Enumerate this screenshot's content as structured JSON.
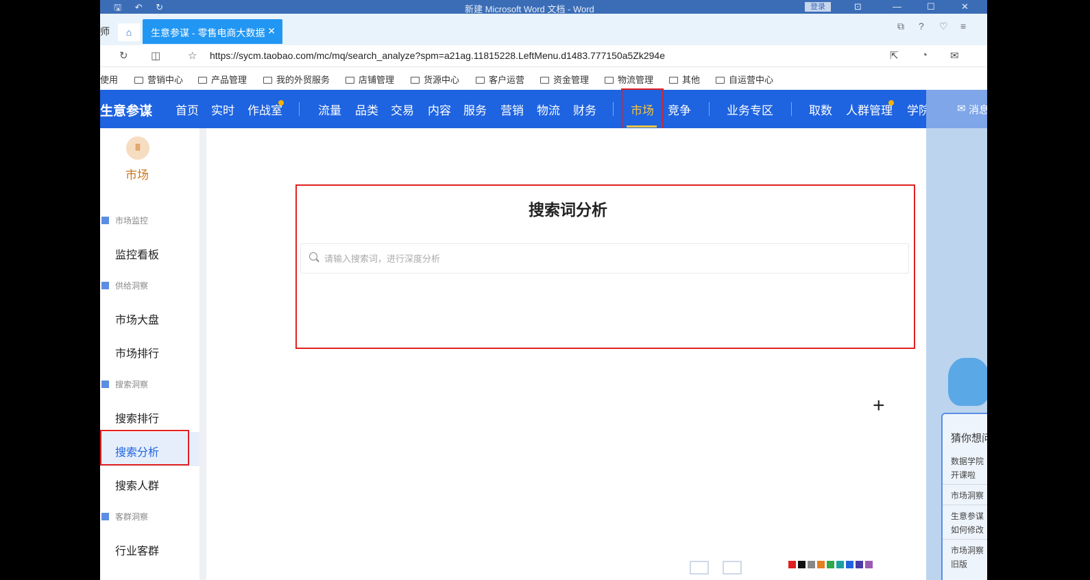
{
  "window": {
    "title": "新建 Microsoft Word 文档 - Word",
    "login_label": "登录",
    "quick_access": "🖫 ↶ ↻"
  },
  "tabs": {
    "prev_fragment": "师",
    "active_label": "生意参谋 - 零售电商大数据",
    "close_glyph": "✕"
  },
  "address": {
    "url": "https://sycm.taobao.com/mc/mq/search_analyze?spm=a21ag.11815228.LeftMenu.d1483.777150a5Zk294e"
  },
  "bookmarks": {
    "lead_fragment": "使用",
    "items": [
      "营销中心",
      "产品管理",
      "我的外贸服务",
      "店铺管理",
      "货源中心",
      "客户运营",
      "资金管理",
      "物流管理",
      "其他",
      "自运营中心"
    ]
  },
  "nav": {
    "brand": "生意参谋",
    "items": [
      "首页",
      "实时",
      "作战室",
      "流量",
      "品类",
      "交易",
      "内容",
      "服务",
      "营销",
      "物流",
      "财务",
      "市场",
      "竞争",
      "业务专区",
      "取数",
      "人群管理",
      "学院"
    ],
    "active": "市场",
    "message_fragment": "消息"
  },
  "sidebar": {
    "module_label": "市场",
    "sections": [
      {
        "title": "市场监控",
        "items": [
          "监控看板"
        ]
      },
      {
        "title": "供给洞察",
        "items": [
          "市场大盘",
          "市场排行"
        ]
      },
      {
        "title": "搜索洞察",
        "items": [
          "搜索排行",
          "搜索分析",
          "搜索人群"
        ]
      },
      {
        "title": "客群洞察",
        "items": [
          "行业客群"
        ]
      }
    ],
    "active_item": "搜索分析"
  },
  "main": {
    "title": "搜索词分析",
    "search_placeholder": "请输入搜索词，进行深度分析"
  },
  "helper": {
    "title_fragment": "猜你想问",
    "questions": [
      "数据学院",
      "开课啦",
      "市场洞察",
      "生意参谋",
      "如何修改",
      "市场洞察",
      "旧版"
    ]
  },
  "palette_colors": [
    "#e02020",
    "#111111",
    "#888888",
    "#e67e22",
    "#2ea84a",
    "#1aa1a1",
    "#1e63e0",
    "#4a3aa8",
    "#9b59b6"
  ]
}
